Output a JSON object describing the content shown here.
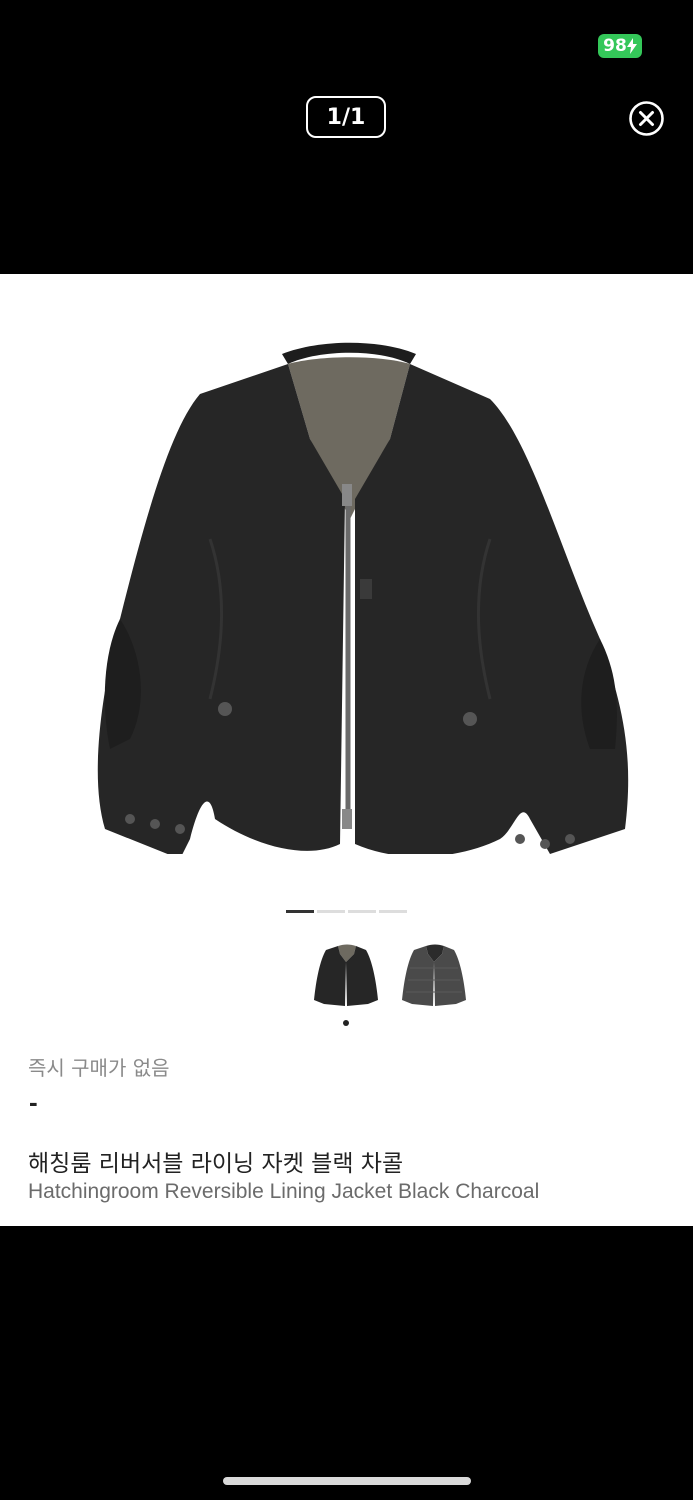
{
  "status_bar": {
    "battery_level": "98"
  },
  "viewer": {
    "counter": "1/1"
  },
  "product": {
    "instant_status": "즉시 구매가 없음",
    "price": "-",
    "name_ko": "해칭룸 리버서블 라이닝 자켓 블랙 차콜",
    "name_en": "Hatchingroom Reversible Lining Jacket Black Charcoal",
    "images": [
      "jacket-black",
      "jacket-charcoal"
    ],
    "image_pager": {
      "pages": 4,
      "active": 1
    }
  },
  "colors": {
    "battery": "#34c759",
    "jacket_black": "#262626",
    "jacket_charcoal": "#4a4a4a",
    "lining": "#6e6a60"
  }
}
